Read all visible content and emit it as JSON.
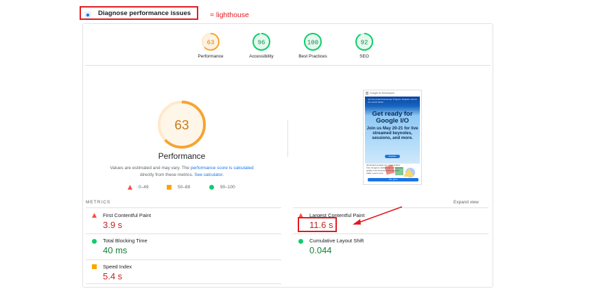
{
  "header": {
    "title": "Diagnose performance issues",
    "annotation": "= lighthouse"
  },
  "categories": [
    {
      "label": "Performance",
      "score": 63,
      "color": "#f6a431"
    },
    {
      "label": "Accessibility",
      "score": 96,
      "color": "#0cce6b"
    },
    {
      "label": "Best Practices",
      "score": 100,
      "color": "#0cce6b"
    },
    {
      "label": "SEO",
      "score": 92,
      "color": "#0cce6b"
    }
  ],
  "main_gauge": {
    "score": "63",
    "label": "Performance"
  },
  "note": {
    "text1": "Values are estimated and may vary. The ",
    "link1": "performance score is calculated",
    "text2": "directly from these metrics. ",
    "link2": "See calculator."
  },
  "legend": {
    "fail": "0–49",
    "average": "50–89",
    "pass": "90–100"
  },
  "screenshot": {
    "site": "Google for Developers",
    "small_text": "Join the Android Developer Program. Register now for our events below.",
    "headline": "Get ready for Google I/O",
    "subhead": "Join us May 20-21 for live streamed keynotes, sessions, and more.",
    "button": "Register",
    "footer_text": "developers.google.com uses cookies from Google to deliver and enhance the quality of its services and to analyze traffic. Learn more.",
    "footer_button": "OK, got it"
  },
  "metrics": {
    "title": "METRICS",
    "expand": "Expand view",
    "fcp": {
      "label": "First Contentful Paint",
      "value": "3.9 s"
    },
    "lcp": {
      "label": "Largest Contentful Paint",
      "value": "11.6 s"
    },
    "tbt": {
      "label": "Total Blocking Time",
      "value": "40 ms"
    },
    "cls": {
      "label": "Cumulative Layout Shift",
      "value": "0.044"
    },
    "si": {
      "label": "Speed Index",
      "value": "5.4 s"
    }
  },
  "colors": {
    "fail": "#ff4e42",
    "average": "#ffa400",
    "pass": "#0cce6b",
    "annotation_red": "#e0191f"
  }
}
